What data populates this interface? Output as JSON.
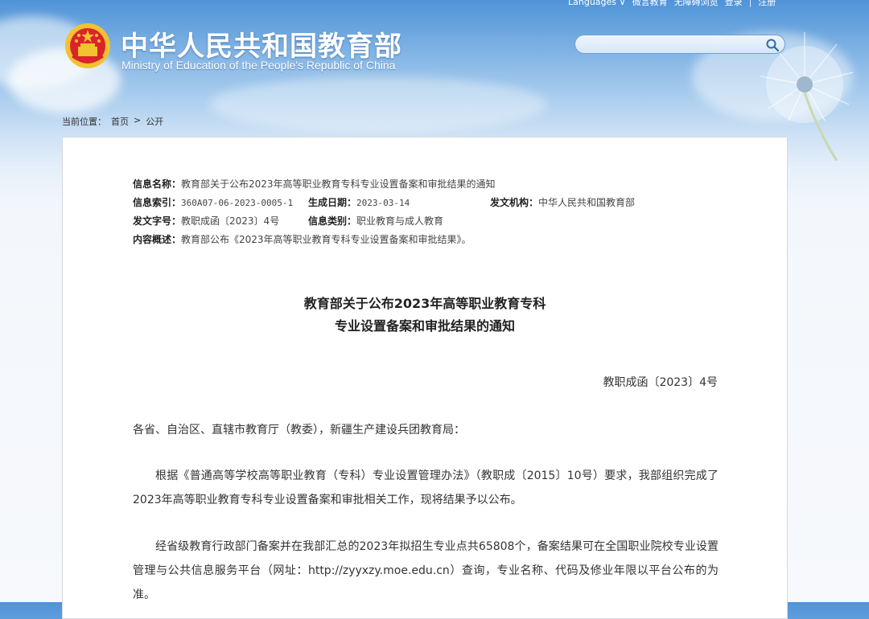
{
  "topbar": {
    "languages": "Languages ∨",
    "weibo": "微言教育",
    "accessible": "无障碍浏览",
    "login": "登录",
    "separator": "|",
    "register": "注册"
  },
  "header": {
    "title": "中华人民共和国教育部",
    "subtitle": "Ministry of Education of the People's Republic of China"
  },
  "search": {
    "placeholder": ""
  },
  "breadcrumb": {
    "label": "当前位置：",
    "home": "首页",
    "separator": ">",
    "current": "公开"
  },
  "meta": {
    "name_label": "信息名称：",
    "name_value": "教育部关于公布2023年高等职业教育专科专业设置备案和审批结果的通知",
    "index_label": "信息索引：",
    "index_value": "360A07-06-2023-0005-1",
    "date_label": "生成日期：",
    "date_value": "2023-03-14",
    "org_label": "发文机构：",
    "org_value": "中华人民共和国教育部",
    "docno_label": "发文字号：",
    "docno_value": "教职成函〔2023〕4号",
    "category_label": "信息类别：",
    "category_value": "职业教育与成人教育",
    "summary_label": "内容概述：",
    "summary_value": "教育部公布《2023年高等职业教育专科专业设置备案和审批结果》。"
  },
  "document": {
    "title_line1": "教育部关于公布2023年高等职业教育专科",
    "title_line2": "专业设置备案和审批结果的通知",
    "doc_number": "教职成函〔2023〕4号",
    "salutation": "各省、自治区、直辖市教育厅（教委），新疆生产建设兵团教育局：",
    "paragraph1": "根据《普通高等学校高等职业教育（专科）专业设置管理办法》（教职成〔2015〕10号）要求，我部组织完成了2023年高等职业教育专科专业设置备案和审批相关工作，现将结果予以公布。",
    "paragraph2": "经省级教育行政部门备案并在我部汇总的2023年拟招生专业点共65808个，备案结果可在全国职业院校专业设置管理与公共信息服务平台（网址：http://zyyxzy.moe.edu.cn）查询，专业名称、代码及修业年限以平台公布的为准。"
  }
}
